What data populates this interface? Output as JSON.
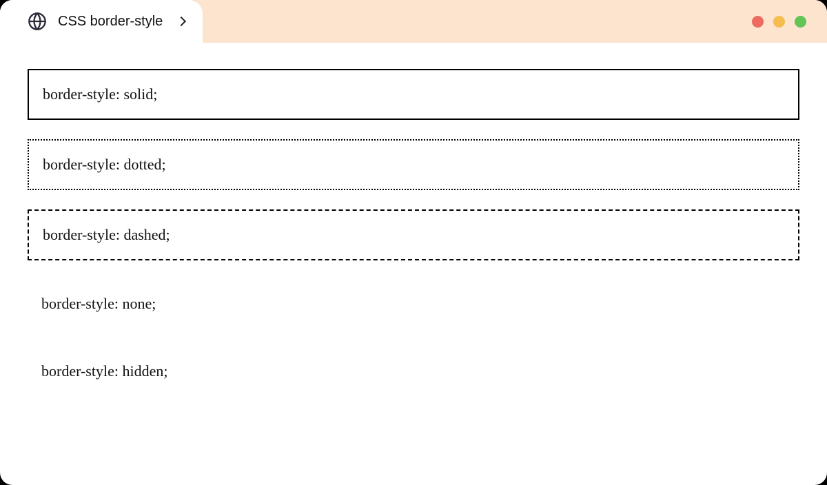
{
  "tab": {
    "title": "CSS border-style"
  },
  "examples": [
    {
      "label": "border-style: solid;",
      "style": "solid"
    },
    {
      "label": "border-style: dotted;",
      "style": "dotted"
    },
    {
      "label": "border-style: dashed;",
      "style": "dashed"
    },
    {
      "label": "border-style: none;",
      "style": "none"
    },
    {
      "label": "border-style: hidden;",
      "style": "hidden"
    }
  ]
}
